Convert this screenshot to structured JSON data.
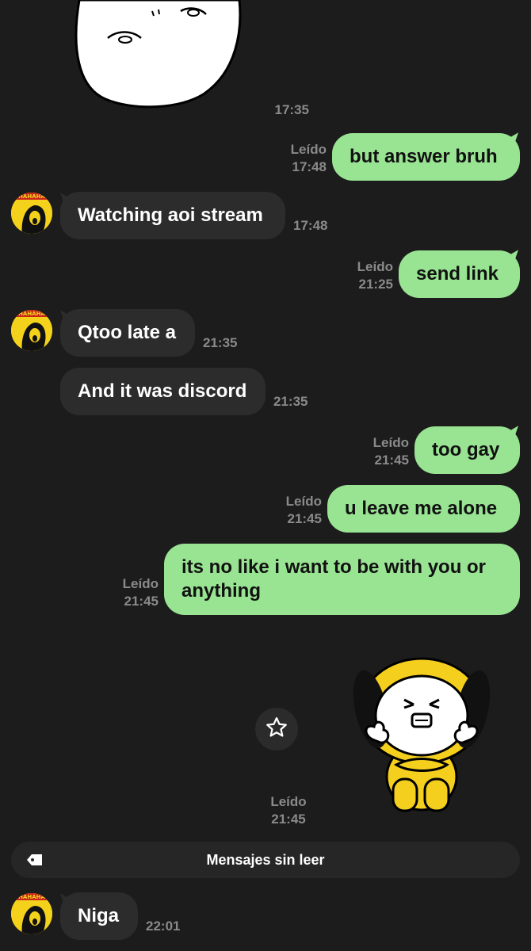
{
  "colors": {
    "background": "#1c1c1c",
    "incoming_bubble": "#2c2c2c",
    "outgoing_bubble": "#98e492",
    "meta_text": "#8a8a8a",
    "avatar_yellow": "#f4d21c"
  },
  "messages": [
    {
      "id": "m0",
      "direction": "in",
      "type": "sticker",
      "sticker": "white-meme-face-sticker",
      "time": "17:35"
    },
    {
      "id": "m1",
      "direction": "out",
      "text": "but answer bruh",
      "status": "Leído",
      "time": "17:48"
    },
    {
      "id": "m2",
      "direction": "in",
      "text": "Watching aoi stream",
      "time": "17:48"
    },
    {
      "id": "m3",
      "direction": "out",
      "text": "send link",
      "status": "Leído",
      "time": "21:25"
    },
    {
      "id": "m4",
      "direction": "in",
      "text": "Qtoo late a",
      "time": "21:35"
    },
    {
      "id": "m5",
      "direction": "in",
      "text": "And it was discord",
      "time": "21:35"
    },
    {
      "id": "m6",
      "direction": "out",
      "text": "too gay",
      "status": "Leído",
      "time": "21:45"
    },
    {
      "id": "m7",
      "direction": "out",
      "text": "u leave me alone",
      "status": "Leído",
      "time": "21:45"
    },
    {
      "id": "m8",
      "direction": "out",
      "text": "its no like i want to be with you or anything",
      "status": "Leído",
      "time": "21:45"
    },
    {
      "id": "m9",
      "direction": "out",
      "type": "sticker",
      "sticker": "yellow-puppy-sticker",
      "status": "Leído",
      "time": "21:45"
    },
    {
      "id": "m10",
      "direction": "in",
      "text": "Niga",
      "time": "22:01"
    }
  ],
  "unread_divider": {
    "label": "Mensajes sin leer",
    "icon": "tag-icon"
  },
  "icons": {
    "favorite": "star-icon",
    "avatar": "contact-avatar"
  }
}
